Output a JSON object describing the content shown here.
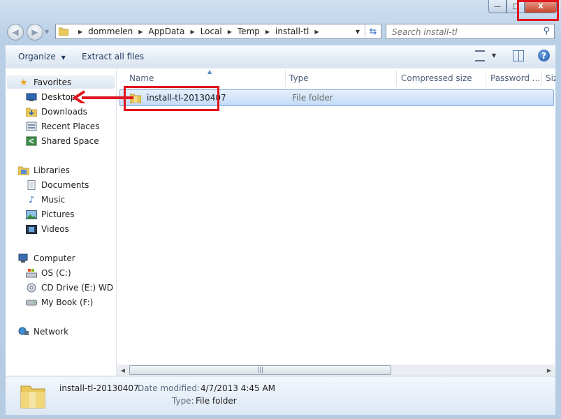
{
  "window": {
    "caption_buttons": {
      "minimize": "—",
      "maximize": "□",
      "close": "X"
    }
  },
  "address": {
    "breadcrumbs": [
      "dommelen",
      "AppData",
      "Local",
      "Temp",
      "install-tl"
    ],
    "search_placeholder": "Search install-tl"
  },
  "toolbar": {
    "organize": "Organize",
    "extract": "Extract all files"
  },
  "nav": {
    "favorites": {
      "header": "Favorites",
      "items": [
        "Desktop",
        "Downloads",
        "Recent Places",
        "Shared Space"
      ]
    },
    "libraries": {
      "header": "Libraries",
      "items": [
        "Documents",
        "Music",
        "Pictures",
        "Videos"
      ]
    },
    "computer": {
      "header": "Computer",
      "items": [
        "OS (C:)",
        "CD Drive (E:) WD Sm",
        "My Book (F:)"
      ]
    },
    "network": {
      "header": "Network"
    }
  },
  "columns": [
    "Name",
    "Type",
    "Compressed size",
    "Password ...",
    "Siz"
  ],
  "files": [
    {
      "name": "install-tl-20130407",
      "type": "File folder"
    }
  ],
  "details": {
    "name": "install-tl-20130407",
    "modified_label": "Date modified:",
    "modified_value": "4/7/2013 4:45 AM",
    "type_label": "Type:",
    "type_value": "File folder"
  },
  "colors": {
    "highlight": "#e0141e",
    "selection": "#c4dcf7"
  }
}
